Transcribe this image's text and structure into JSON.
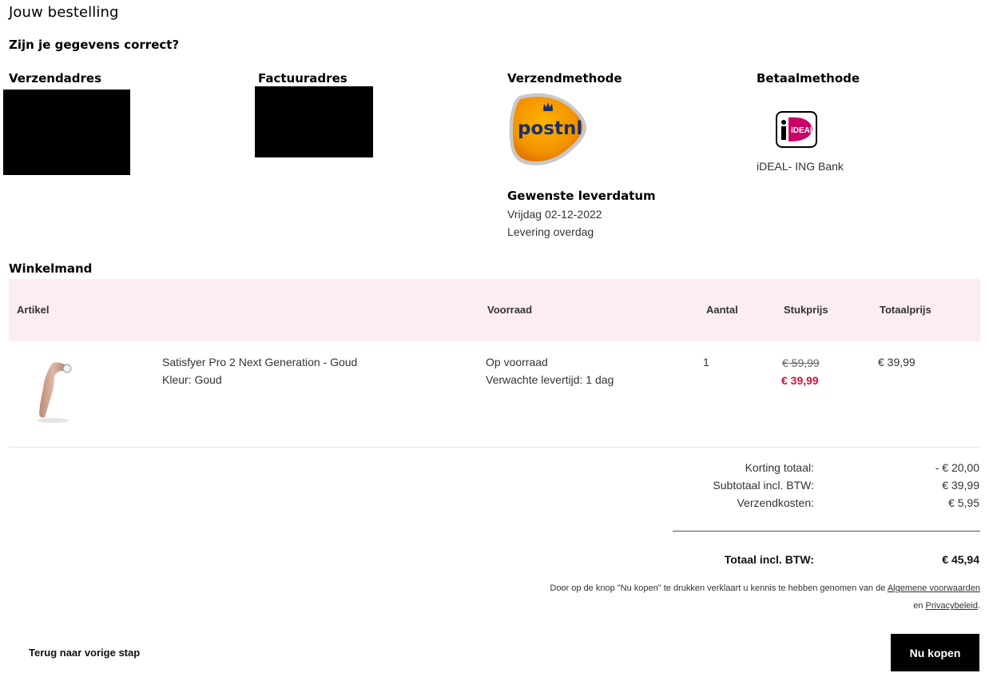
{
  "page": {
    "title": "Jouw bestelling",
    "subtitle": "Zijn je gegevens correct?"
  },
  "shipping_address": {
    "heading": "Verzendadres"
  },
  "billing_address": {
    "heading": "Factuuradres"
  },
  "shipping_method": {
    "heading": "Verzendmethode",
    "logo_text": "postnl",
    "logo_icon": "postnl-logo",
    "delivery_heading": "Gewenste leverdatum",
    "delivery_date": "Vrijdag 02-12-2022",
    "delivery_window": "Levering overdag"
  },
  "payment_method": {
    "heading": "Betaalmethode",
    "logo_text": "iDEAL",
    "logo_icon": "ideal-logo",
    "label": "iDEAL- ING Bank"
  },
  "cart": {
    "heading": "Winkelmand",
    "columns": {
      "article": "Artikel",
      "stock": "Voorraad",
      "quantity": "Aantal",
      "unit_price": "Stukprijs",
      "total_price": "Totaalprijs"
    },
    "items": [
      {
        "name": "Satisfyer Pro 2 Next Generation - Goud",
        "variant": "Kleur: Goud",
        "stock": "Op voorraad",
        "lead_time": "Verwachte levertijd: 1 dag",
        "quantity": "1",
        "old_price": "€ 59,99",
        "new_price": "€ 39,99",
        "total": "€ 39,99"
      }
    ]
  },
  "summary": {
    "discount_label": "Korting totaal:",
    "discount_value": "- € 20,00",
    "subtotal_label": "Subtotaal incl. BTW:",
    "subtotal_value": "€ 39,99",
    "shipping_label": "Verzendkosten:",
    "shipping_value": "€ 5,95",
    "total_label": "Totaal incl. BTW:",
    "total_value": "€ 45,94"
  },
  "terms": {
    "line1": "Door op de knop \"Nu kopen\" te drukken verklaart u kennis te hebben genomen van de",
    "terms_link": "Algemene voorwaarden",
    "line2_prefix": "en",
    "privacy_link": "Privacybeleid",
    "line2_suffix": "."
  },
  "actions": {
    "back_label": "Terug naar vorige stap",
    "buy_label": "Nu kopen"
  },
  "colors": {
    "accent_price": "#d2123c",
    "table_header_bg": "#fbedf1",
    "button_bg": "#000000",
    "postnl_orange": "#f39200",
    "ideal_pink": "#cc0066"
  }
}
